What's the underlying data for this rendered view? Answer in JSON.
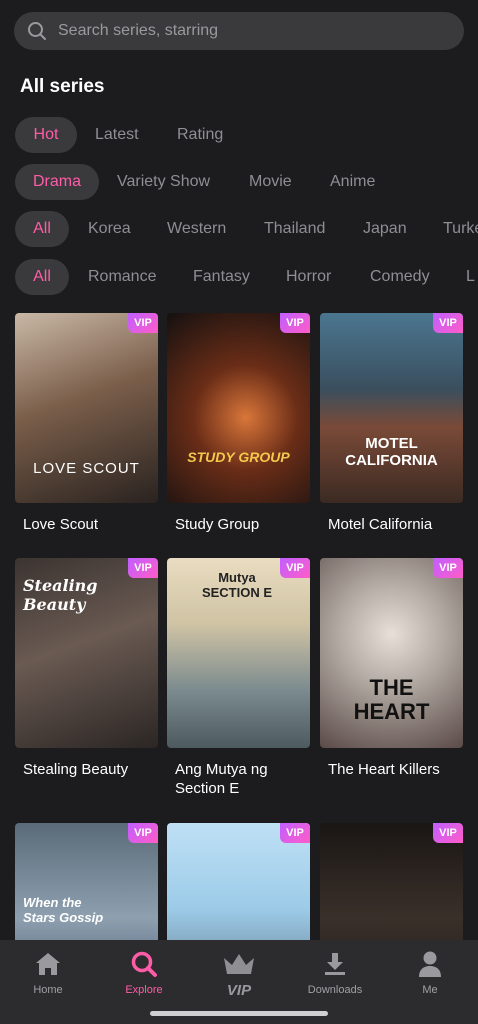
{
  "search": {
    "placeholder": "Search series, starring"
  },
  "section_title": "All series",
  "sort_filters": [
    {
      "label": "Hot",
      "active": true
    },
    {
      "label": "Latest",
      "active": false
    },
    {
      "label": "Rating",
      "active": false
    }
  ],
  "type_filters": [
    {
      "label": "Drama",
      "active": true
    },
    {
      "label": "Variety Show",
      "active": false
    },
    {
      "label": "Movie",
      "active": false
    },
    {
      "label": "Anime",
      "active": false
    }
  ],
  "region_filters": [
    {
      "label": "All",
      "active": true
    },
    {
      "label": "Korea",
      "active": false
    },
    {
      "label": "Western",
      "active": false
    },
    {
      "label": "Thailand",
      "active": false
    },
    {
      "label": "Japan",
      "active": false
    },
    {
      "label": "Turke",
      "active": false
    }
  ],
  "genre_filters": [
    {
      "label": "All",
      "active": true
    },
    {
      "label": "Romance",
      "active": false
    },
    {
      "label": "Fantasy",
      "active": false
    },
    {
      "label": "Horror",
      "active": false
    },
    {
      "label": "Comedy",
      "active": false
    },
    {
      "label": "L",
      "active": false
    }
  ],
  "vip_badge": "VIP",
  "series": [
    {
      "title": "Love Scout",
      "poster_text": "LOVE SCOUT",
      "vip": true
    },
    {
      "title": "Study Group",
      "poster_text": "STUDY GROUP",
      "vip": true
    },
    {
      "title": "Motel California",
      "poster_text": "MOTEL CALIFORNIA",
      "vip": true
    },
    {
      "title": "Stealing Beauty",
      "poster_text": "Stealing Beauty",
      "vip": true
    },
    {
      "title": "Ang Mutya ng Section E",
      "poster_text": "Mutya SECTION E",
      "vip": true
    },
    {
      "title": "The Heart Killers",
      "poster_text": "THE HEART",
      "vip": true
    },
    {
      "title": "",
      "poster_text": "When the Stars Gossip",
      "vip": true
    },
    {
      "title": "",
      "poster_text": "",
      "vip": true
    },
    {
      "title": "",
      "poster_text": "",
      "vip": true
    }
  ],
  "nav": [
    {
      "label": "Home",
      "icon": "home-icon",
      "active": false
    },
    {
      "label": "Explore",
      "icon": "explore-icon",
      "active": true
    },
    {
      "label": "VIP",
      "icon": "crown-icon",
      "active": false
    },
    {
      "label": "Downloads",
      "icon": "download-icon",
      "active": false
    },
    {
      "label": "Me",
      "icon": "user-icon",
      "active": false
    }
  ],
  "colors": {
    "accent": "#ff5ca8",
    "background": "#1c1c1e",
    "chip": "#3a3a3c"
  }
}
